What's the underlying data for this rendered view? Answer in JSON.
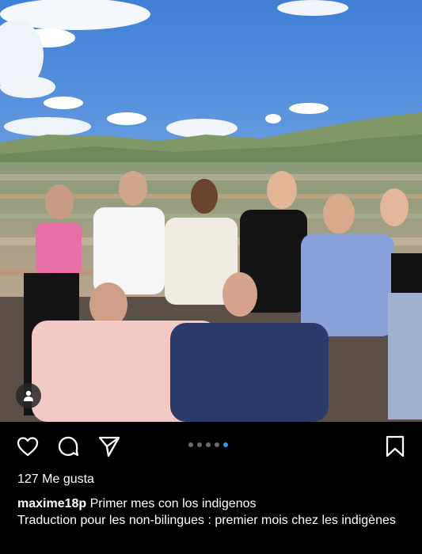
{
  "post": {
    "photo_alt": "",
    "likes_text": "127 Me gusta",
    "username": "maxime18p",
    "caption_line1": "Primer mes con los indigenos",
    "caption_line2": "Traduction pour les non-bilingues : premier mois chez les indigènes",
    "carousel": {
      "total": 5,
      "active_index": 4
    }
  },
  "icons": {
    "like": "heart-icon",
    "comment": "comment-icon",
    "share": "send-icon",
    "save": "bookmark-icon",
    "tagged": "user-tag-icon"
  },
  "colors": {
    "background": "#000000",
    "active_dot": "#3897f0",
    "inactive_dot": "#6b6b6b",
    "text": "#ffffff"
  }
}
